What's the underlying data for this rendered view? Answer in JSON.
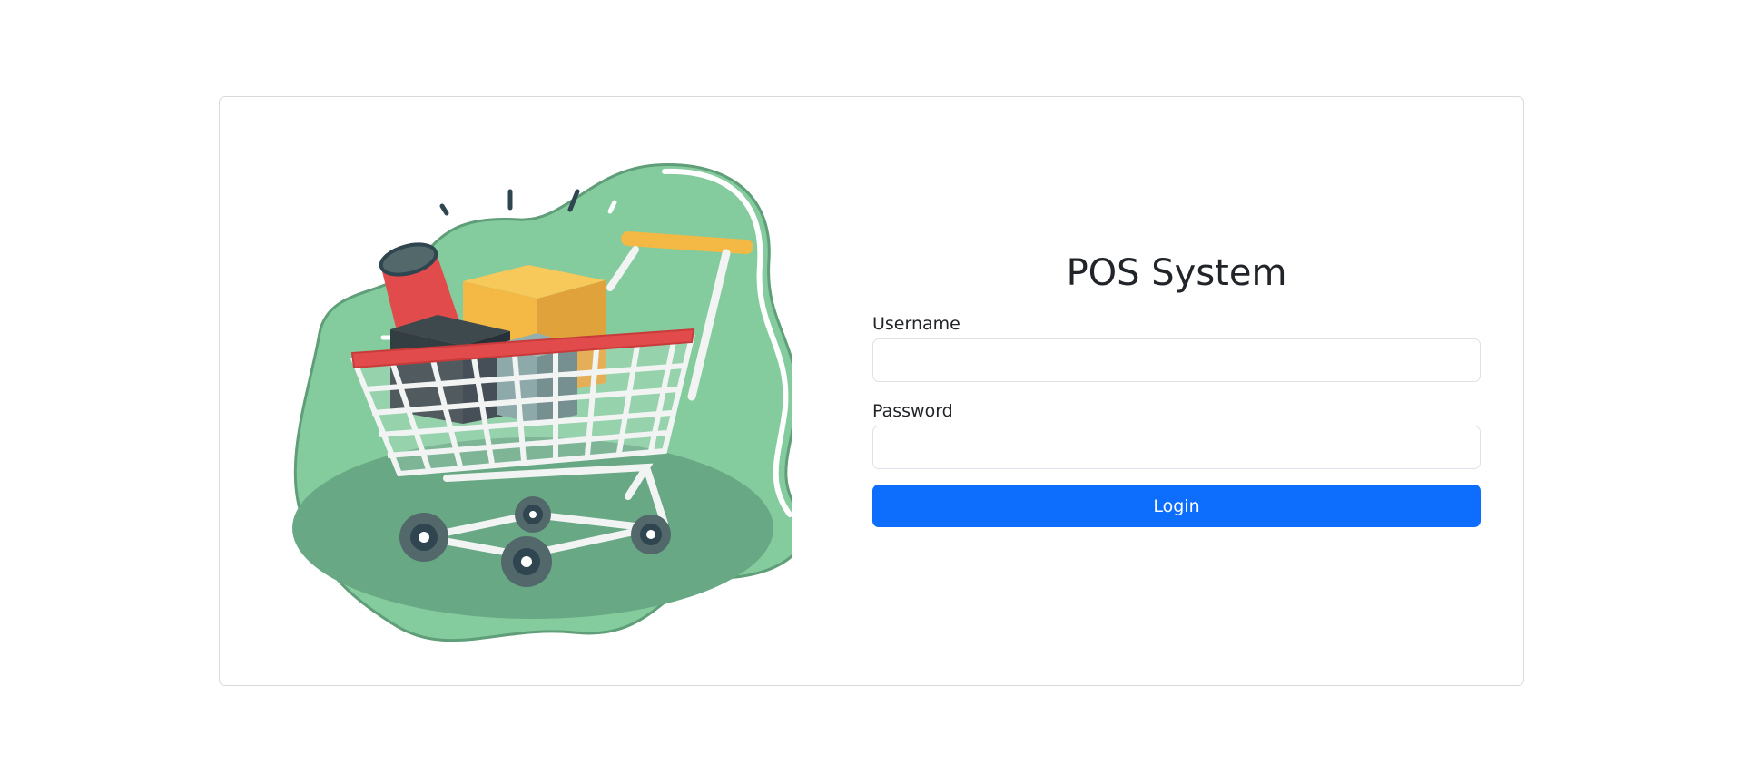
{
  "login": {
    "title": "POS System",
    "username_label": "Username",
    "username_value": "",
    "password_label": "Password",
    "password_value": "",
    "button_label": "Login"
  },
  "illustration": {
    "icon": "shopping-cart-illustration"
  },
  "colors": {
    "primary": "#0d6efd",
    "blob_light": "#84cb9d",
    "blob_dark": "#68a884",
    "cart_rim": "#e24b4b",
    "box_yellow": "#f4b844",
    "box_dark": "#333e42",
    "box_gray": "#7a9a9a"
  }
}
